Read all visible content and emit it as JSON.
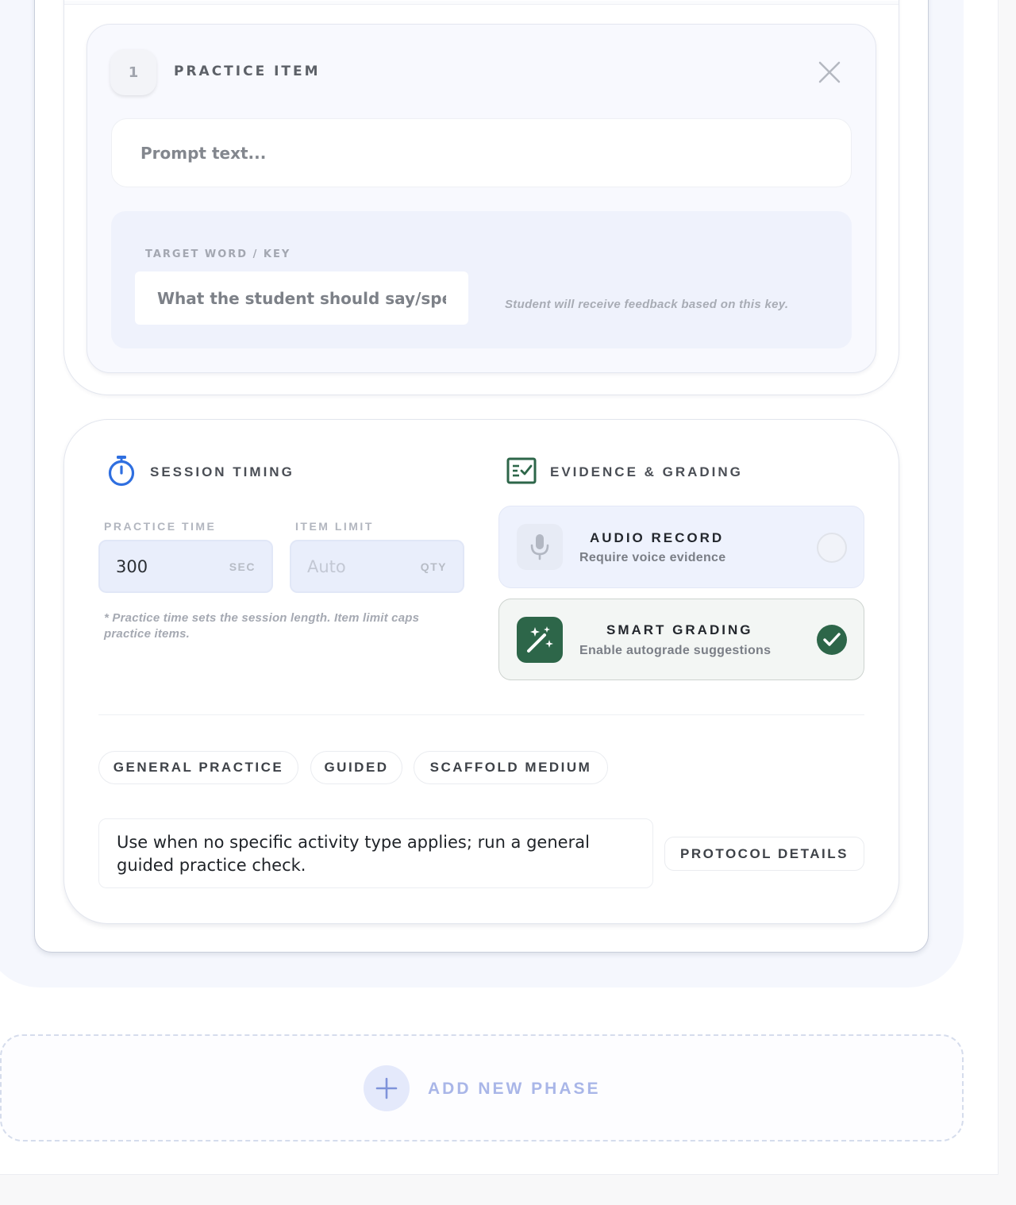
{
  "practice_item": {
    "number": "1",
    "title": "PRACTICE ITEM",
    "prompt_placeholder": "Prompt text...",
    "target_label": "TARGET WORD / KEY",
    "target_placeholder": "What the student should say/spe",
    "target_hint": "Student will receive feedback based on this key."
  },
  "session_timing": {
    "title": "SESSION TIMING",
    "icon": "stopwatch-icon",
    "practice_time_label": "PRACTICE TIME",
    "practice_time_value": "300",
    "practice_time_unit": "SEC",
    "item_limit_label": "ITEM LIMIT",
    "item_limit_placeholder": "Auto",
    "item_limit_unit": "QTY",
    "note": "* Practice time sets the session length. Item limit caps practice items."
  },
  "evidence": {
    "title": "EVIDENCE & GRADING",
    "icon": "checklist-icon",
    "options": [
      {
        "title": "AUDIO RECORD",
        "subtitle": "Require voice evidence",
        "icon": "microphone-icon",
        "checked": false
      },
      {
        "title": "SMART GRADING",
        "subtitle": "Enable autograde suggestions",
        "icon": "magic-wand-icon",
        "checked": true
      }
    ]
  },
  "tags": [
    "GENERAL PRACTICE",
    "GUIDED",
    "SCAFFOLD MEDIUM"
  ],
  "description": "Use when no specific activity type applies; run a general guided practice check.",
  "protocol_button": "PROTOCOL DETAILS",
  "add_phase_label": "ADD NEW PHASE",
  "colors": {
    "accent_blue": "#2f6fe0",
    "accent_green": "#2d6649",
    "add_phase_text": "#a9b6e8"
  }
}
